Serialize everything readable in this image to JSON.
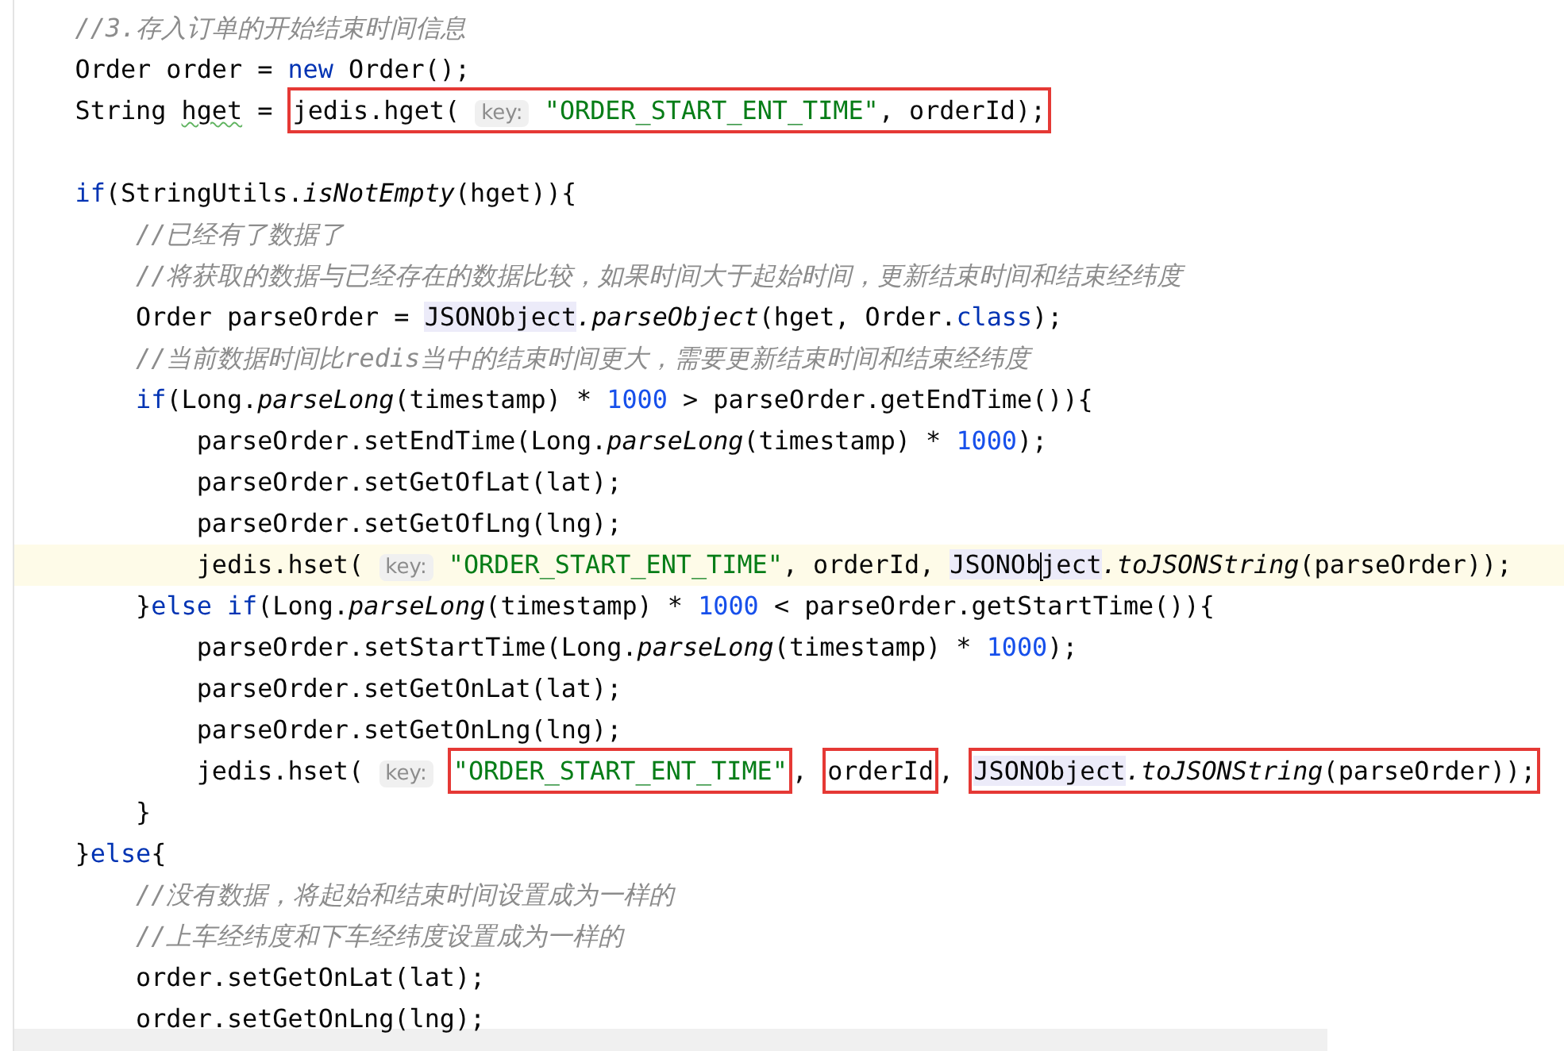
{
  "editor": {
    "lines": [
      {
        "current": false,
        "tokens": [
          {
            "kind": "comment",
            "text": "    //3.存入订单的开始结束时间信息"
          }
        ]
      },
      {
        "current": false,
        "tokens": [
          {
            "kind": "code",
            "text": "    Order order = "
          },
          {
            "kind": "keyword",
            "text": "new"
          },
          {
            "kind": "code",
            "text": " Order();"
          }
        ]
      },
      {
        "current": false,
        "tokens": [
          {
            "kind": "code",
            "text": "    String "
          },
          {
            "kind": "warning",
            "text": "hget"
          },
          {
            "kind": "code",
            "text": " = "
          },
          {
            "kind": "box",
            "tokens": [
              {
                "kind": "code",
                "text": "jedis.hget( "
              },
              {
                "kind": "hint",
                "text": "key:"
              },
              {
                "kind": "string",
                "text": " \"ORDER_START_ENT_TIME\""
              },
              {
                "kind": "code",
                "text": ", orderId);"
              }
            ]
          }
        ]
      },
      {
        "current": false
      },
      {
        "current": false,
        "tokens": [
          {
            "kind": "keyword",
            "text": "    if"
          },
          {
            "kind": "code",
            "text": "(StringUtils."
          },
          {
            "kind": "method",
            "text": "isNotEmpty"
          },
          {
            "kind": "code",
            "text": "(hget)){"
          }
        ]
      },
      {
        "current": false,
        "tokens": [
          {
            "kind": "comment",
            "text": "        //已经有了数据了"
          }
        ]
      },
      {
        "current": false,
        "tokens": [
          {
            "kind": "comment",
            "text": "        //将获取的数据与已经存在的数据比较，如果时间大于起始时间，更新结束时间和结束经纬度"
          }
        ]
      },
      {
        "current": false,
        "tokens": [
          {
            "kind": "code",
            "text": "        Order parseOrder = "
          },
          {
            "kind": "highlight",
            "text": "JSONObject"
          },
          {
            "kind": "method",
            "text": ".parseObject"
          },
          {
            "kind": "code",
            "text": "(hget, Order."
          },
          {
            "kind": "keyword",
            "text": "class"
          },
          {
            "kind": "code",
            "text": ");"
          }
        ]
      },
      {
        "current": false,
        "tokens": [
          {
            "kind": "comment",
            "text": "        //当前数据时间比redis当中的结束时间更大，需要更新结束时间和结束经纬度"
          }
        ]
      },
      {
        "current": false,
        "tokens": [
          {
            "kind": "keyword",
            "text": "        if"
          },
          {
            "kind": "code",
            "text": "(Long."
          },
          {
            "kind": "method",
            "text": "parseLong"
          },
          {
            "kind": "code",
            "text": "(timestamp) * "
          },
          {
            "kind": "number",
            "text": "1000"
          },
          {
            "kind": "code",
            "text": " > parseOrder.getEndTime()){"
          }
        ]
      },
      {
        "current": false,
        "tokens": [
          {
            "kind": "code",
            "text": "            parseOrder.setEndTime(Long."
          },
          {
            "kind": "method",
            "text": "parseLong"
          },
          {
            "kind": "code",
            "text": "(timestamp) * "
          },
          {
            "kind": "number",
            "text": "1000"
          },
          {
            "kind": "code",
            "text": ");"
          }
        ]
      },
      {
        "current": false,
        "tokens": [
          {
            "kind": "code",
            "text": "            parseOrder.setGetOfLat(lat);"
          }
        ]
      },
      {
        "current": false,
        "tokens": [
          {
            "kind": "code",
            "text": "            parseOrder.setGetOfLng(lng);"
          }
        ]
      },
      {
        "current": true,
        "tokens": [
          {
            "kind": "code",
            "text": "            jedis.hset( "
          },
          {
            "kind": "hint",
            "text": "key:"
          },
          {
            "kind": "string",
            "text": " \"ORDER_START_ENT_TIME\""
          },
          {
            "kind": "code",
            "text": ", orderId, "
          },
          {
            "kind": "highlight",
            "text": "JSONOb"
          },
          {
            "kind": "cursor"
          },
          {
            "kind": "highlight",
            "text": "ject"
          },
          {
            "kind": "method",
            "text": ".toJSONString"
          },
          {
            "kind": "code",
            "text": "(parseOrder));"
          }
        ]
      },
      {
        "current": false,
        "tokens": [
          {
            "kind": "code",
            "text": "        }"
          },
          {
            "kind": "keyword",
            "text": "else if"
          },
          {
            "kind": "code",
            "text": "(Long."
          },
          {
            "kind": "method",
            "text": "parseLong"
          },
          {
            "kind": "code",
            "text": "(timestamp) * "
          },
          {
            "kind": "number",
            "text": "1000"
          },
          {
            "kind": "code",
            "text": " < parseOrder.getStartTime()){"
          }
        ]
      },
      {
        "current": false,
        "tokens": [
          {
            "kind": "code",
            "text": "            parseOrder.setStartTime(Long."
          },
          {
            "kind": "method",
            "text": "parseLong"
          },
          {
            "kind": "code",
            "text": "(timestamp) * "
          },
          {
            "kind": "number",
            "text": "1000"
          },
          {
            "kind": "code",
            "text": ");"
          }
        ]
      },
      {
        "current": false,
        "tokens": [
          {
            "kind": "code",
            "text": "            parseOrder.setGetOnLat(lat);"
          }
        ]
      },
      {
        "current": false,
        "tokens": [
          {
            "kind": "code",
            "text": "            parseOrder.setGetOnLng(lng);"
          }
        ]
      },
      {
        "current": false,
        "tokens": [
          {
            "kind": "code",
            "text": "            jedis.hset( "
          },
          {
            "kind": "hint",
            "text": "key: "
          },
          {
            "kind": "box",
            "tokens": [
              {
                "kind": "string",
                "text": "\"ORDER_START_ENT_TIME\""
              }
            ]
          },
          {
            "kind": "code",
            "text": ", "
          },
          {
            "kind": "box",
            "tokens": [
              {
                "kind": "code",
                "text": "orderId"
              }
            ]
          },
          {
            "kind": "code",
            "text": ", "
          },
          {
            "kind": "box",
            "tokens": [
              {
                "kind": "highlight",
                "text": "JSONObject"
              },
              {
                "kind": "method",
                "text": ".toJSONString"
              },
              {
                "kind": "code",
                "text": "(parseOrder));"
              }
            ]
          }
        ]
      },
      {
        "current": false,
        "tokens": [
          {
            "kind": "code",
            "text": "        }"
          }
        ]
      },
      {
        "current": false,
        "tokens": [
          {
            "kind": "code",
            "text": "    }"
          },
          {
            "kind": "keyword",
            "text": "else"
          },
          {
            "kind": "code",
            "text": "{"
          }
        ]
      },
      {
        "current": false,
        "tokens": [
          {
            "kind": "comment",
            "text": "        //没有数据，将起始和结束时间设置成为一样的"
          }
        ]
      },
      {
        "current": false,
        "tokens": [
          {
            "kind": "comment",
            "text": "        //上车经纬度和下车经纬度设置成为一样的"
          }
        ]
      },
      {
        "current": false,
        "tokens": [
          {
            "kind": "code",
            "text": "        order.setGetOnLat(lat);"
          }
        ]
      },
      {
        "current": false,
        "tokens": [
          {
            "kind": "code",
            "text": "        order.setGetOnLng(lng);"
          }
        ]
      }
    ]
  }
}
